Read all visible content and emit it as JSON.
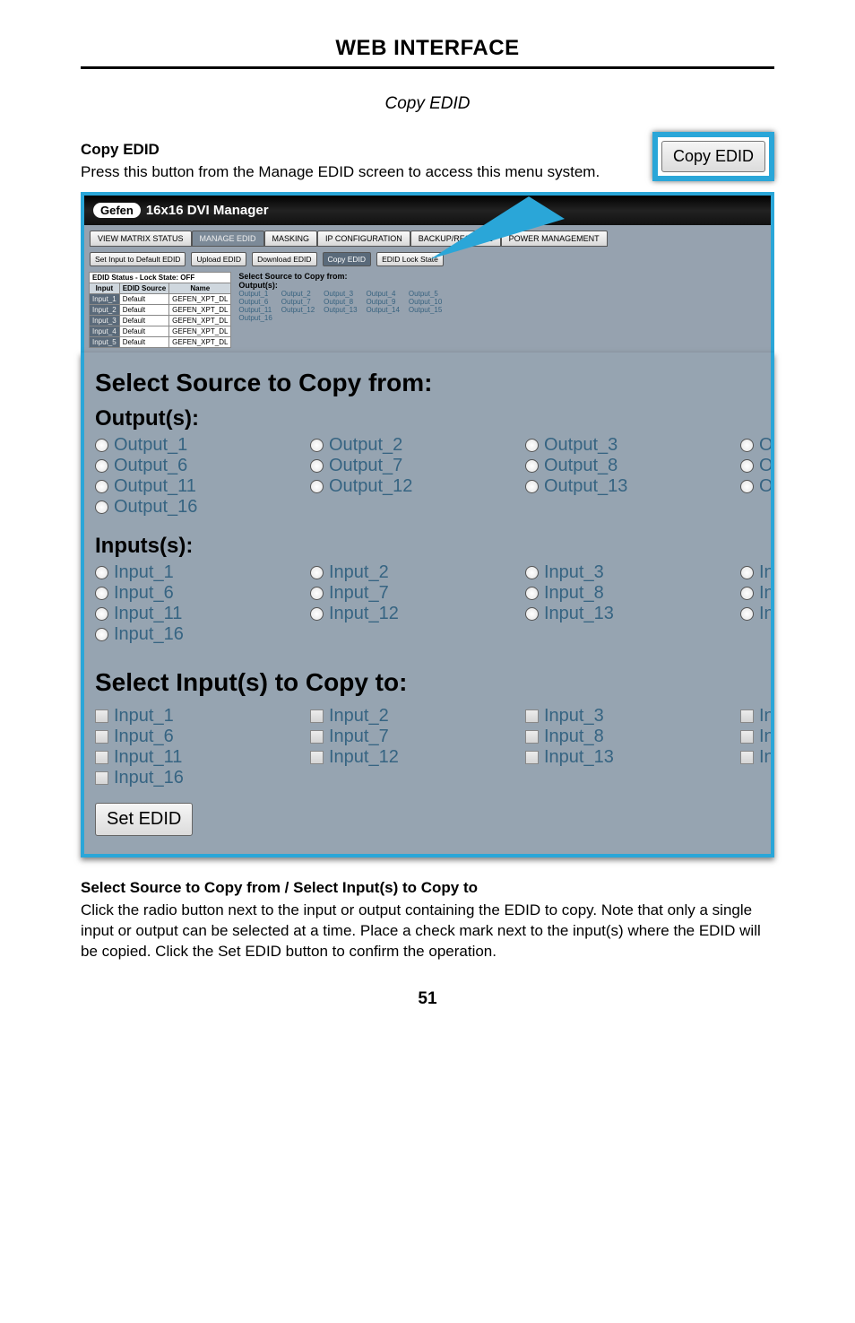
{
  "page": {
    "header": "WEB INTERFACE",
    "sectionItalic": "Copy EDID",
    "number": "51"
  },
  "intro": {
    "title": "Copy EDID",
    "body": "Press this button from the Manage EDID screen to access this menu system.",
    "calloutButton": "Copy EDID"
  },
  "app": {
    "brand": "Gefen",
    "title": "16x16 DVI Manager",
    "tabs": [
      "VIEW MATRIX STATUS",
      "MANAGE EDID",
      "MASKING",
      "IP CONFIGURATION",
      "BACKUP/RESTORE",
      "POWER MANAGEMENT"
    ],
    "buttons": [
      "Set Input to Default EDID",
      "Upload EDID",
      "Download EDID",
      "Copy EDID",
      "EDID Lock State"
    ],
    "edidCaption": "EDID Status - Lock State: OFF",
    "edidCols": [
      "Input",
      "EDID Source",
      "Name"
    ],
    "edidRows": [
      [
        "Input_1",
        "Default",
        "GEFEN_XPT_DL"
      ],
      [
        "Input_2",
        "Default",
        "GEFEN_XPT_DL"
      ],
      [
        "Input_3",
        "Default",
        "GEFEN_XPT_DL"
      ],
      [
        "Input_4",
        "Default",
        "GEFEN_XPT_DL"
      ],
      [
        "Input_5",
        "Default",
        "GEFEN_XPT_DL"
      ]
    ],
    "smallCopyTitle": "Select Source to Copy from:",
    "smallOutputsLabel": "Output(s):",
    "smallOutputs": [
      "Output_1",
      "Output_2",
      "Output_3",
      "Output_4",
      "Output_5",
      "Output_6",
      "Output_7",
      "Output_8",
      "Output_9",
      "Output_10",
      "Output_11",
      "Output_12",
      "Output_13",
      "Output_14",
      "Output_15",
      "Output_16"
    ]
  },
  "zoom": {
    "title": "Select Source to Copy from:",
    "outputsLabel": "Output(s):",
    "outputs": {
      "c1": [
        "Output_1",
        "Output_6",
        "Output_11",
        "Output_16"
      ],
      "c2": [
        "Output_2",
        "Output_7",
        "Output_12"
      ],
      "c3": [
        "Output_3",
        "Output_8",
        "Output_13"
      ],
      "c4": [
        "Outpu",
        "Outpu",
        "Outpu"
      ]
    },
    "inputsLabel": "Inputs(s):",
    "inputs": {
      "c1": [
        "Input_1",
        "Input_6",
        "Input_11",
        "Input_16"
      ],
      "c2": [
        "Input_2",
        "Input_7",
        "Input_12"
      ],
      "c3": [
        "Input_3",
        "Input_8",
        "Input_13"
      ],
      "c4": [
        "Input_",
        "Input_",
        "Input_"
      ]
    },
    "copyToTitle": "Select Input(s) to Copy to:",
    "copyTo": {
      "c1": [
        "Input_1",
        "Input_6",
        "Input_11",
        "Input_16"
      ],
      "c2": [
        "Input_2",
        "Input_7",
        "Input_12"
      ],
      "c3": [
        "Input_3",
        "Input_8",
        "Input_13"
      ],
      "c4": [
        "Input_",
        "Input_",
        "Input_"
      ]
    },
    "setButton": "Set EDID"
  },
  "footer": {
    "heading": "Select Source to Copy from / Select Input(s) to Copy to",
    "body": "Click the radio button next to the input or output containing the EDID to copy. Note that only a single input or output can be selected at a time.  Place a check mark next to the input(s) where the EDID will be copied.  Click the Set EDID button to confirm the operation."
  }
}
